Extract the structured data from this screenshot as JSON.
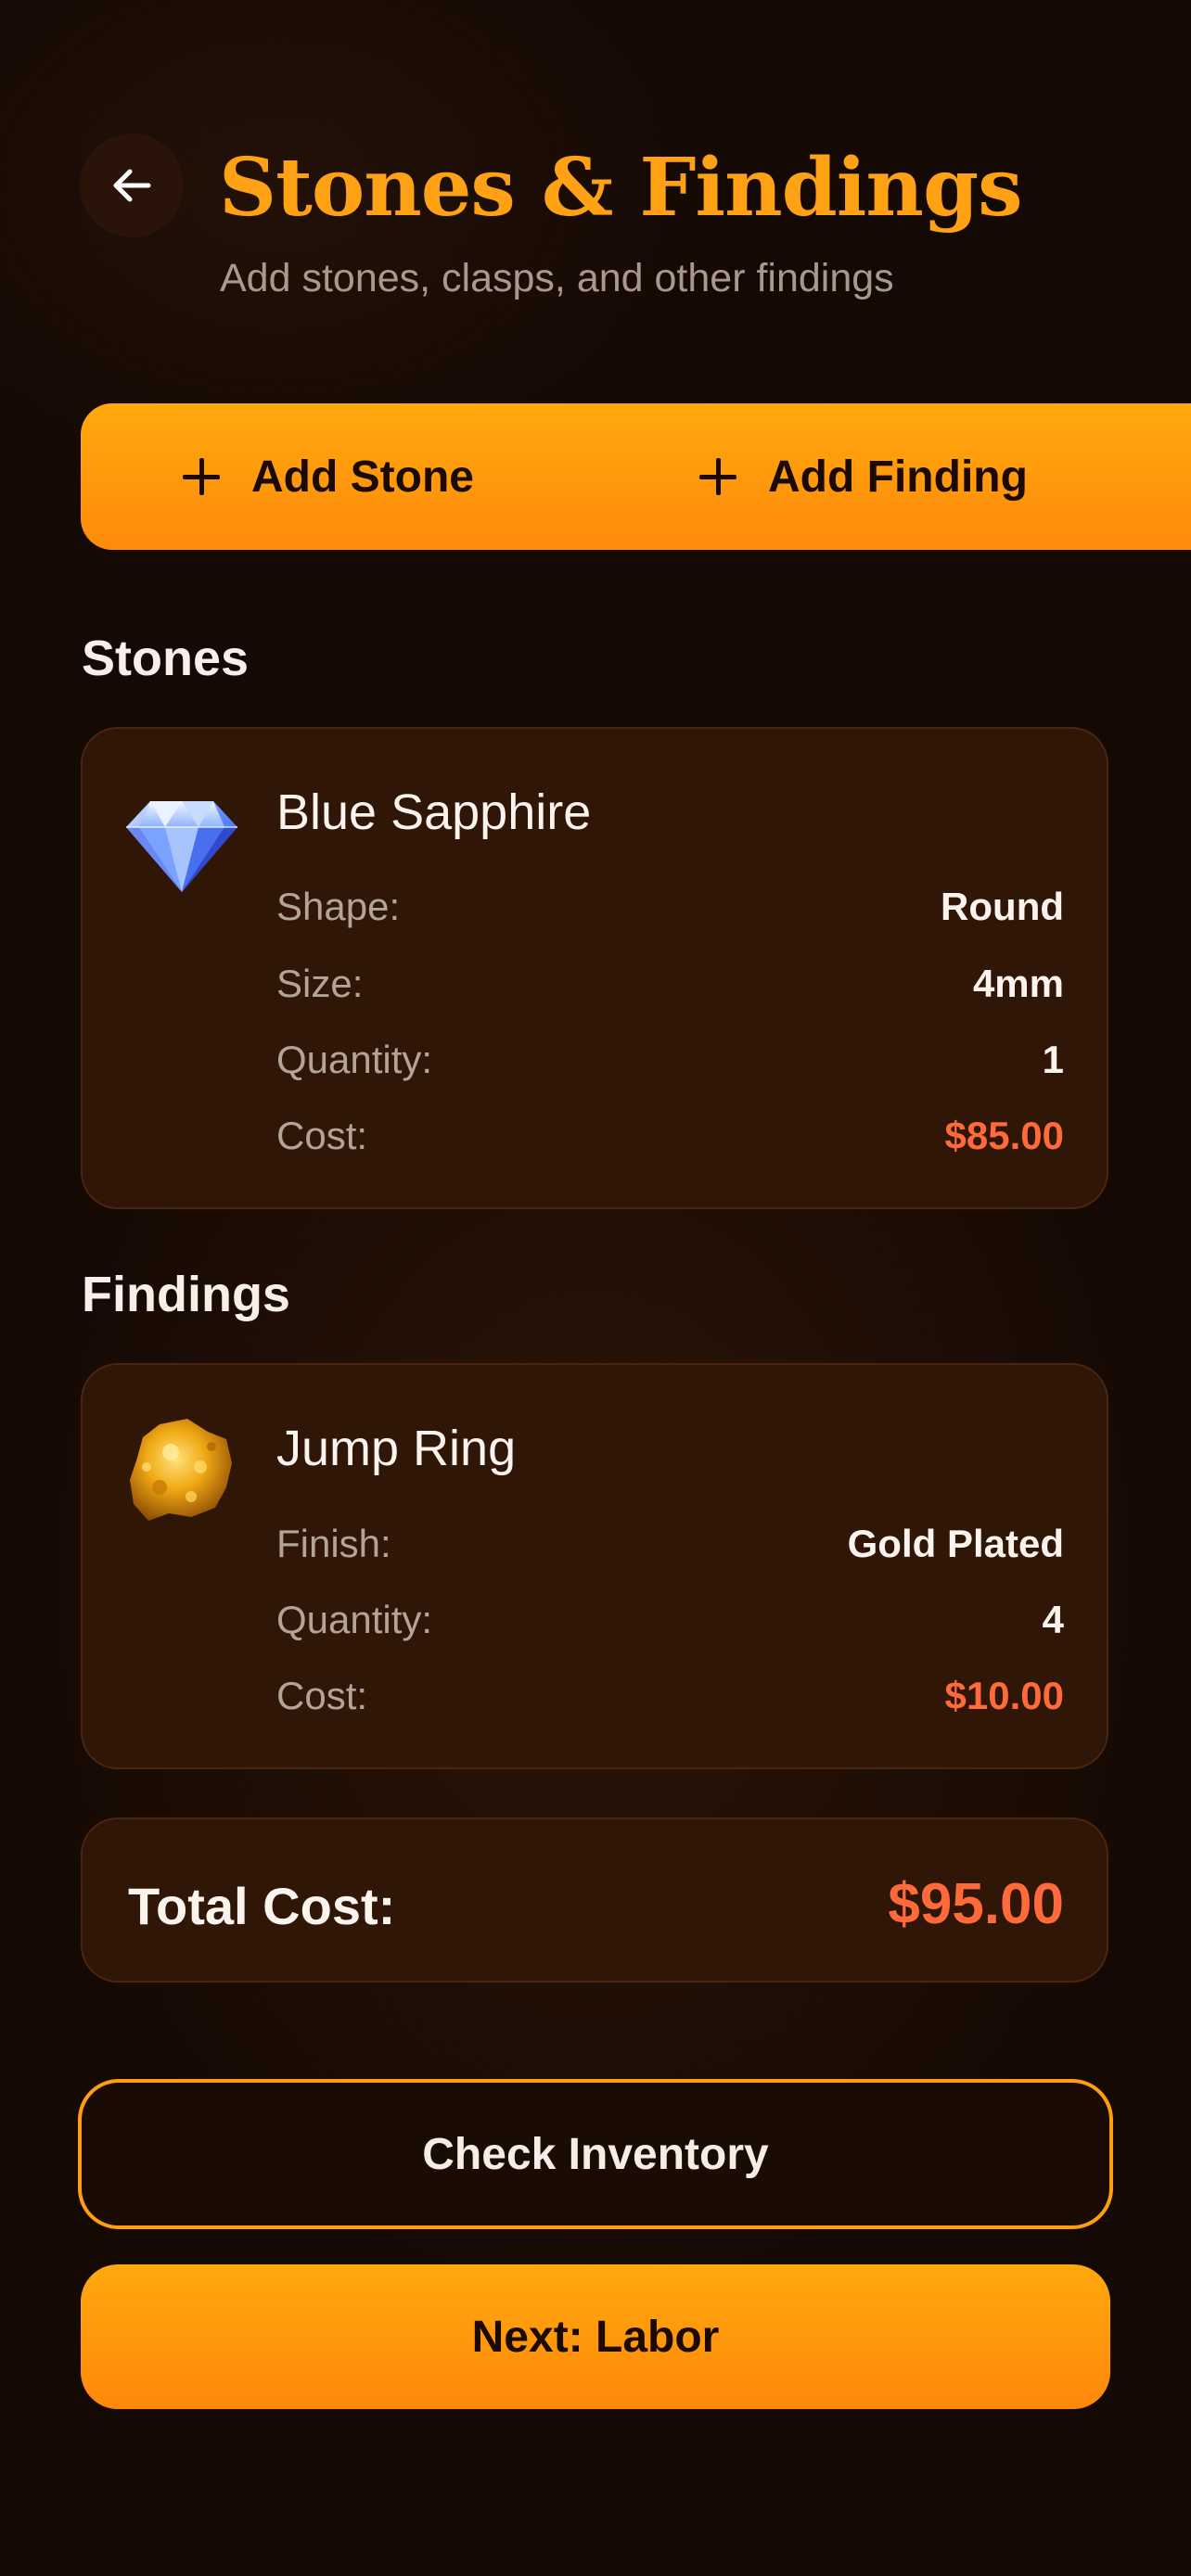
{
  "header": {
    "back_icon": "arrow-left-icon",
    "title": "Stones & Findings",
    "subtitle": "Add stones, clasps, and other findings"
  },
  "actions": {
    "add_stone": "Add Stone",
    "add_finding": "Add Finding",
    "add_icon": "plus-icon"
  },
  "stones": {
    "heading": "Stones",
    "items": [
      {
        "icon": "diamond-icon",
        "name": "Blue Sapphire",
        "rows": [
          {
            "label": "Shape:",
            "value": "Round"
          },
          {
            "label": "Size:",
            "value": "4mm"
          },
          {
            "label": "Quantity:",
            "value": "1"
          },
          {
            "label": "Cost:",
            "value": "$85.00"
          }
        ]
      }
    ]
  },
  "findings": {
    "heading": "Findings",
    "items": [
      {
        "icon": "gold-nugget-icon",
        "name": "Jump Ring",
        "rows": [
          {
            "label": "Finish:",
            "value": "Gold Plated"
          },
          {
            "label": "Quantity:",
            "value": "4"
          },
          {
            "label": "Cost:",
            "value": "$10.00"
          }
        ]
      }
    ]
  },
  "total": {
    "label": "Total Cost:",
    "value": "$95.00"
  },
  "buttons": {
    "check_inventory": "Check Inventory",
    "next": "Next: Labor"
  },
  "colors": {
    "accent": "#ffa114",
    "cost": "#ff6a3a",
    "background": "#150904",
    "card": "#301607"
  }
}
